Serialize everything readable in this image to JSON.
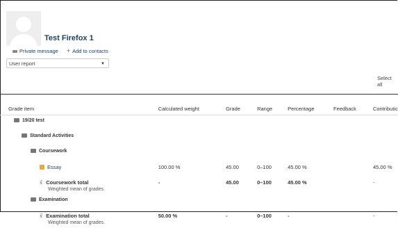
{
  "user": {
    "name": "Test Firefox 1"
  },
  "actions": {
    "message": "Private message",
    "contacts": "Add to contacts"
  },
  "report_select": {
    "selected": "User report"
  },
  "select_all": "Select all",
  "table": {
    "headers": [
      "Grade item",
      "Calculated weight",
      "Grade",
      "Range",
      "Percentage",
      "Feedback",
      "Contributic"
    ],
    "rows": [
      {
        "type": "course",
        "label": "19/20 test"
      },
      {
        "type": "category",
        "label": "Standard Activities"
      },
      {
        "type": "category",
        "label": "Coursework"
      },
      {
        "type": "item",
        "label": "Essay",
        "weight": "100.00 %",
        "grade": "45.00",
        "range": "0–100",
        "percentage": "45.00 %",
        "feedback": "",
        "contribution": "45.00 %"
      },
      {
        "type": "total",
        "label": "Coursework total",
        "sub": "Weighted mean of grades.",
        "weight": "-",
        "grade": "45.00",
        "range": "0–100",
        "percentage": "45.00 %",
        "feedback": "",
        "contribution": "-"
      },
      {
        "type": "category",
        "label": "Examination"
      },
      {
        "type": "total",
        "label": "Examination total",
        "sub": "Weighted mean of grades.",
        "weight": "50.00 %",
        "grade": "-",
        "range": "0–100",
        "percentage": "-",
        "feedback": "",
        "contribution": "-"
      }
    ]
  }
}
